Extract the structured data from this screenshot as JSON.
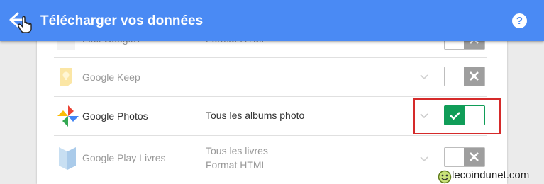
{
  "header": {
    "title": "Télécharger vos données",
    "help_label": "?"
  },
  "colors": {
    "header_blue": "#4a8af4",
    "toggle_on_green": "#109d58",
    "toggle_off_gray": "#9e9e9e",
    "highlight_red": "#d52a2a"
  },
  "rows": [
    {
      "name": "Flux Google+",
      "format": "Format HTML",
      "enabled": false,
      "icon": "rss-feed-icon"
    },
    {
      "name": "Google Keep",
      "format": "",
      "enabled": false,
      "icon": "lightbulb-icon"
    },
    {
      "name": "Google Photos",
      "format": "Tous les albums photo",
      "enabled": true,
      "icon": "pinwheel-icon"
    },
    {
      "name": "Google Play Livres",
      "format_line1": "Tous les livres",
      "format_line2": "Format HTML",
      "enabled": false,
      "icon": "book-icon"
    }
  ],
  "watermark": {
    "text": "lecoindunet.com"
  }
}
